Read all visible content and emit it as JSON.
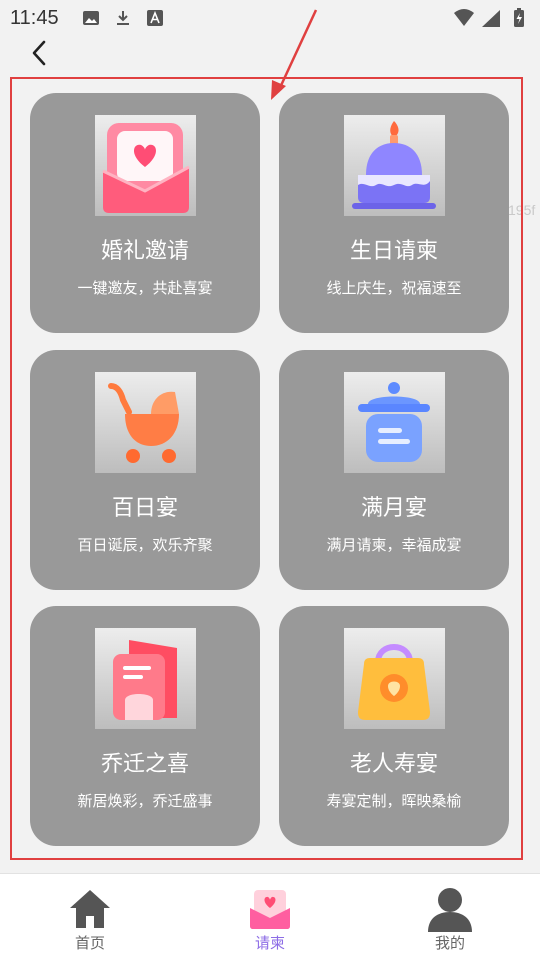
{
  "status_bar": {
    "time": "11:45",
    "left_icons": [
      "image-icon",
      "download-icon",
      "text-icon"
    ],
    "right_icons": [
      "wifi-icon",
      "signal-icon",
      "battery-icon"
    ]
  },
  "header": {
    "back_icon": "chevron-left-icon"
  },
  "annotation": {
    "side_text": "195f",
    "arrow_color": "#e04040",
    "box_color": "#e04040"
  },
  "cards": [
    {
      "title": "婚礼邀请",
      "subtitle": "一键邀友，共赴喜宴",
      "icon": "wedding-envelope-icon"
    },
    {
      "title": "生日请柬",
      "subtitle": "线上庆生，祝福速至",
      "icon": "birthday-cake-icon"
    },
    {
      "title": "百日宴",
      "subtitle": "百日诞辰，欢乐齐聚",
      "icon": "baby-stroller-icon"
    },
    {
      "title": "满月宴",
      "subtitle": "满月请柬，幸福成宴",
      "icon": "baby-bottle-jar-icon"
    },
    {
      "title": "乔迁之喜",
      "subtitle": "新居焕彩，乔迁盛事",
      "icon": "new-home-icon"
    },
    {
      "title": "老人寿宴",
      "subtitle": "寿宴定制，晖映桑榆",
      "icon": "gift-bag-icon"
    }
  ],
  "tabbar": {
    "items": [
      {
        "label": "首页",
        "icon": "home-icon"
      },
      {
        "label": "请柬",
        "icon": "invitation-icon",
        "active": true
      },
      {
        "label": "我的",
        "icon": "user-icon"
      }
    ],
    "active_color": "#8d6de6"
  },
  "colors": {
    "card_bg": "#999999",
    "page_bg": "#f2f2f2"
  }
}
